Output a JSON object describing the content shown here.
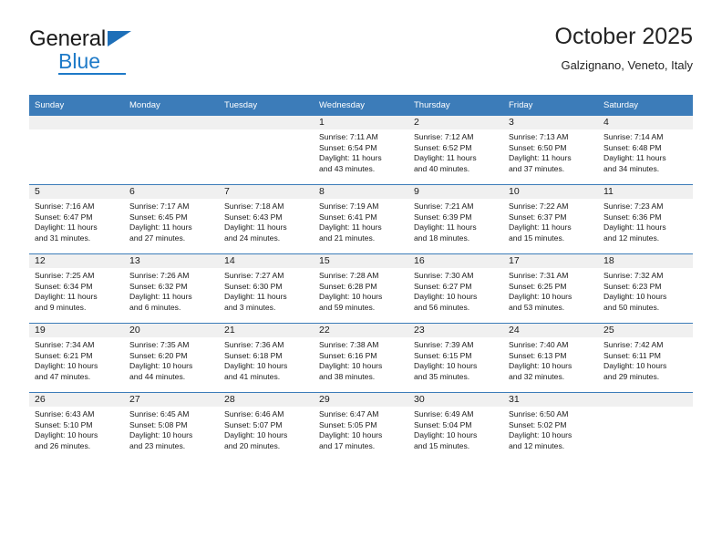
{
  "brand": {
    "name_part1": "General",
    "name_part2": "Blue",
    "accent_color": "#1e7ac8",
    "logo_triangle_color": "#1e6fb8"
  },
  "header": {
    "title": "October 2025",
    "subtitle": "Galzignano, Veneto, Italy",
    "header_row_color": "#3c7cb9"
  },
  "weekday_headers": [
    "Sunday",
    "Monday",
    "Tuesday",
    "Wednesday",
    "Thursday",
    "Friday",
    "Saturday"
  ],
  "labels": {
    "sunrise_prefix": "Sunrise:",
    "sunset_prefix": "Sunset:",
    "daylight_prefix": "Daylight:"
  },
  "weeks": [
    [
      {
        "day": "",
        "sunrise": "",
        "sunset": "",
        "daylight_line1": "",
        "daylight_line2": ""
      },
      {
        "day": "",
        "sunrise": "",
        "sunset": "",
        "daylight_line1": "",
        "daylight_line2": ""
      },
      {
        "day": "",
        "sunrise": "",
        "sunset": "",
        "daylight_line1": "",
        "daylight_line2": ""
      },
      {
        "day": "1",
        "sunrise": "Sunrise: 7:11 AM",
        "sunset": "Sunset: 6:54 PM",
        "daylight_line1": "Daylight: 11 hours",
        "daylight_line2": "and 43 minutes."
      },
      {
        "day": "2",
        "sunrise": "Sunrise: 7:12 AM",
        "sunset": "Sunset: 6:52 PM",
        "daylight_line1": "Daylight: 11 hours",
        "daylight_line2": "and 40 minutes."
      },
      {
        "day": "3",
        "sunrise": "Sunrise: 7:13 AM",
        "sunset": "Sunset: 6:50 PM",
        "daylight_line1": "Daylight: 11 hours",
        "daylight_line2": "and 37 minutes."
      },
      {
        "day": "4",
        "sunrise": "Sunrise: 7:14 AM",
        "sunset": "Sunset: 6:48 PM",
        "daylight_line1": "Daylight: 11 hours",
        "daylight_line2": "and 34 minutes."
      }
    ],
    [
      {
        "day": "5",
        "sunrise": "Sunrise: 7:16 AM",
        "sunset": "Sunset: 6:47 PM",
        "daylight_line1": "Daylight: 11 hours",
        "daylight_line2": "and 31 minutes."
      },
      {
        "day": "6",
        "sunrise": "Sunrise: 7:17 AM",
        "sunset": "Sunset: 6:45 PM",
        "daylight_line1": "Daylight: 11 hours",
        "daylight_line2": "and 27 minutes."
      },
      {
        "day": "7",
        "sunrise": "Sunrise: 7:18 AM",
        "sunset": "Sunset: 6:43 PM",
        "daylight_line1": "Daylight: 11 hours",
        "daylight_line2": "and 24 minutes."
      },
      {
        "day": "8",
        "sunrise": "Sunrise: 7:19 AM",
        "sunset": "Sunset: 6:41 PM",
        "daylight_line1": "Daylight: 11 hours",
        "daylight_line2": "and 21 minutes."
      },
      {
        "day": "9",
        "sunrise": "Sunrise: 7:21 AM",
        "sunset": "Sunset: 6:39 PM",
        "daylight_line1": "Daylight: 11 hours",
        "daylight_line2": "and 18 minutes."
      },
      {
        "day": "10",
        "sunrise": "Sunrise: 7:22 AM",
        "sunset": "Sunset: 6:37 PM",
        "daylight_line1": "Daylight: 11 hours",
        "daylight_line2": "and 15 minutes."
      },
      {
        "day": "11",
        "sunrise": "Sunrise: 7:23 AM",
        "sunset": "Sunset: 6:36 PM",
        "daylight_line1": "Daylight: 11 hours",
        "daylight_line2": "and 12 minutes."
      }
    ],
    [
      {
        "day": "12",
        "sunrise": "Sunrise: 7:25 AM",
        "sunset": "Sunset: 6:34 PM",
        "daylight_line1": "Daylight: 11 hours",
        "daylight_line2": "and 9 minutes."
      },
      {
        "day": "13",
        "sunrise": "Sunrise: 7:26 AM",
        "sunset": "Sunset: 6:32 PM",
        "daylight_line1": "Daylight: 11 hours",
        "daylight_line2": "and 6 minutes."
      },
      {
        "day": "14",
        "sunrise": "Sunrise: 7:27 AM",
        "sunset": "Sunset: 6:30 PM",
        "daylight_line1": "Daylight: 11 hours",
        "daylight_line2": "and 3 minutes."
      },
      {
        "day": "15",
        "sunrise": "Sunrise: 7:28 AM",
        "sunset": "Sunset: 6:28 PM",
        "daylight_line1": "Daylight: 10 hours",
        "daylight_line2": "and 59 minutes."
      },
      {
        "day": "16",
        "sunrise": "Sunrise: 7:30 AM",
        "sunset": "Sunset: 6:27 PM",
        "daylight_line1": "Daylight: 10 hours",
        "daylight_line2": "and 56 minutes."
      },
      {
        "day": "17",
        "sunrise": "Sunrise: 7:31 AM",
        "sunset": "Sunset: 6:25 PM",
        "daylight_line1": "Daylight: 10 hours",
        "daylight_line2": "and 53 minutes."
      },
      {
        "day": "18",
        "sunrise": "Sunrise: 7:32 AM",
        "sunset": "Sunset: 6:23 PM",
        "daylight_line1": "Daylight: 10 hours",
        "daylight_line2": "and 50 minutes."
      }
    ],
    [
      {
        "day": "19",
        "sunrise": "Sunrise: 7:34 AM",
        "sunset": "Sunset: 6:21 PM",
        "daylight_line1": "Daylight: 10 hours",
        "daylight_line2": "and 47 minutes."
      },
      {
        "day": "20",
        "sunrise": "Sunrise: 7:35 AM",
        "sunset": "Sunset: 6:20 PM",
        "daylight_line1": "Daylight: 10 hours",
        "daylight_line2": "and 44 minutes."
      },
      {
        "day": "21",
        "sunrise": "Sunrise: 7:36 AM",
        "sunset": "Sunset: 6:18 PM",
        "daylight_line1": "Daylight: 10 hours",
        "daylight_line2": "and 41 minutes."
      },
      {
        "day": "22",
        "sunrise": "Sunrise: 7:38 AM",
        "sunset": "Sunset: 6:16 PM",
        "daylight_line1": "Daylight: 10 hours",
        "daylight_line2": "and 38 minutes."
      },
      {
        "day": "23",
        "sunrise": "Sunrise: 7:39 AM",
        "sunset": "Sunset: 6:15 PM",
        "daylight_line1": "Daylight: 10 hours",
        "daylight_line2": "and 35 minutes."
      },
      {
        "day": "24",
        "sunrise": "Sunrise: 7:40 AM",
        "sunset": "Sunset: 6:13 PM",
        "daylight_line1": "Daylight: 10 hours",
        "daylight_line2": "and 32 minutes."
      },
      {
        "day": "25",
        "sunrise": "Sunrise: 7:42 AM",
        "sunset": "Sunset: 6:11 PM",
        "daylight_line1": "Daylight: 10 hours",
        "daylight_line2": "and 29 minutes."
      }
    ],
    [
      {
        "day": "26",
        "sunrise": "Sunrise: 6:43 AM",
        "sunset": "Sunset: 5:10 PM",
        "daylight_line1": "Daylight: 10 hours",
        "daylight_line2": "and 26 minutes."
      },
      {
        "day": "27",
        "sunrise": "Sunrise: 6:45 AM",
        "sunset": "Sunset: 5:08 PM",
        "daylight_line1": "Daylight: 10 hours",
        "daylight_line2": "and 23 minutes."
      },
      {
        "day": "28",
        "sunrise": "Sunrise: 6:46 AM",
        "sunset": "Sunset: 5:07 PM",
        "daylight_line1": "Daylight: 10 hours",
        "daylight_line2": "and 20 minutes."
      },
      {
        "day": "29",
        "sunrise": "Sunrise: 6:47 AM",
        "sunset": "Sunset: 5:05 PM",
        "daylight_line1": "Daylight: 10 hours",
        "daylight_line2": "and 17 minutes."
      },
      {
        "day": "30",
        "sunrise": "Sunrise: 6:49 AM",
        "sunset": "Sunset: 5:04 PM",
        "daylight_line1": "Daylight: 10 hours",
        "daylight_line2": "and 15 minutes."
      },
      {
        "day": "31",
        "sunrise": "Sunrise: 6:50 AM",
        "sunset": "Sunset: 5:02 PM",
        "daylight_line1": "Daylight: 10 hours",
        "daylight_line2": "and 12 minutes."
      },
      {
        "day": "",
        "sunrise": "",
        "sunset": "",
        "daylight_line1": "",
        "daylight_line2": ""
      }
    ]
  ]
}
